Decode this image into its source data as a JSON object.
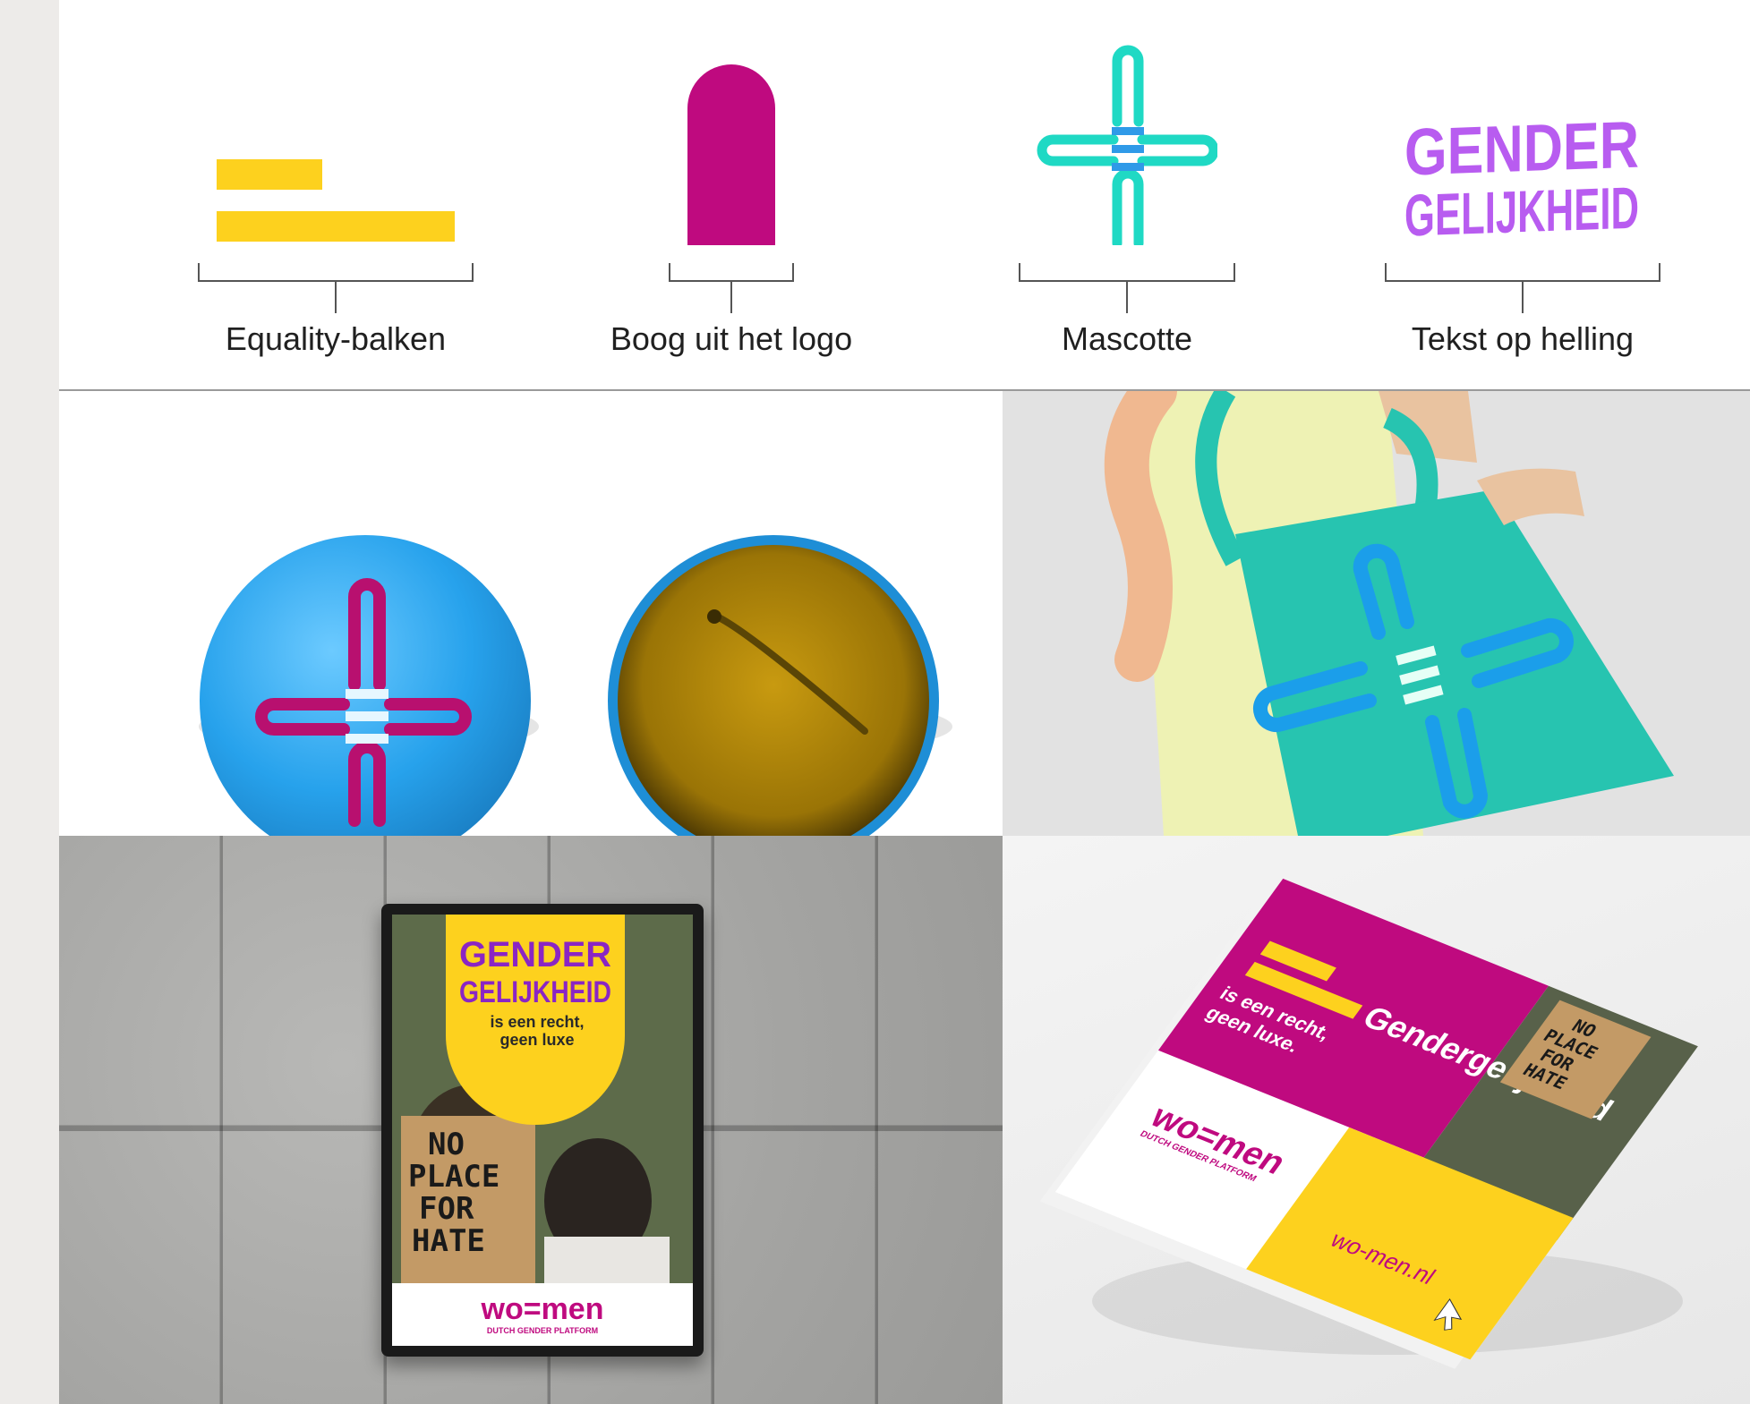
{
  "captions": {
    "equality": "Equality-balken",
    "arch": "Boog uit het logo",
    "mascot": "Mascotte",
    "text": "Tekst op helling"
  },
  "gender_logo": {
    "line1": "GENDER",
    "line2": "GELIJKHEID"
  },
  "poster": {
    "title1": "GENDER",
    "title2": "GELIJKHEID",
    "sub1": "is een recht,",
    "sub2": "geen luxe",
    "sign": [
      "NO",
      "PLACE",
      "FOR",
      "HATE"
    ],
    "brand": "wo=men",
    "brand_sub": "DUTCH GENDER PLATFORM"
  },
  "book": {
    "title": "Gendergelijkheid",
    "sub1": "is een recht,",
    "sub2": "geen luxe.",
    "brand": "wo=men",
    "brand_sub": "DUTCH GENDER PLATFORM",
    "url": "wo-men.nl",
    "sign": [
      "NO",
      "PLACE",
      "FOR",
      "HATE"
    ]
  },
  "colors": {
    "yellow": "#fdd11e",
    "magenta": "#bf0a7f",
    "teal": "#1fd9c4",
    "blue": "#2f9ae8",
    "purple": "#b85cf0",
    "badge_blue": "#27a2ec",
    "tote_teal": "#27c4b0"
  }
}
